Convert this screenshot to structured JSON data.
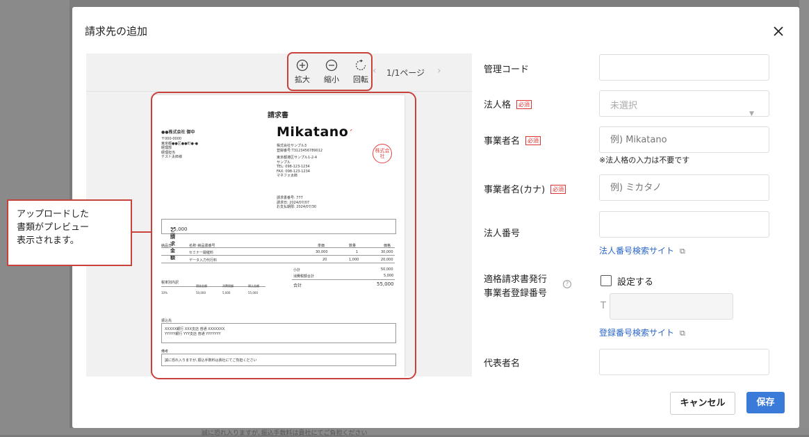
{
  "modal": {
    "title": "請求先の追加"
  },
  "preview": {
    "zoom_in_label": "拡大",
    "zoom_out_label": "縮小",
    "rotate_label": "回転",
    "pager": "1/1ページ"
  },
  "document": {
    "title": "請求書",
    "recipient": "●●株式会社 御中",
    "recipient_lines": [
      "〒000-0000",
      "東京都●●区●●町●-●",
      "経理部",
      "経理担当",
      "テスト太郎様"
    ],
    "logo": "Mikatano",
    "issuer_lines": [
      "株式会社サンプル3",
      "登録番号:T3123456789012",
      "",
      "東京都港区サンプル1-2-4",
      "サンプル",
      "TEL: 098-123-1234",
      "FAX: 098-123-1234",
      "マネフォ太郎"
    ],
    "meta_lines": [
      "請求書番号: 777",
      "請求日:    2024/07/07",
      "お支払期限: 2024/07/30"
    ],
    "seal_text": "株式会社",
    "amount_label": "ご請求金額",
    "amount_value": "55,000 円",
    "table_headers": [
      "納品日",
      "名称･納品書番号",
      "単価",
      "数量",
      "価格"
    ],
    "table_rows": [
      [
        "",
        "セミナー開催料",
        "30,000",
        "1",
        "30,000"
      ],
      [
        "",
        "データ入力代行料",
        "20",
        "1,000",
        "20,000"
      ]
    ],
    "tax_title": "税率別内訳",
    "tax_headers": [
      "税抜金額",
      "消費税額",
      "税込金額"
    ],
    "tax_row": [
      "10%",
      "50,000",
      "5,000",
      "55,000"
    ],
    "subtotal_label": "小計",
    "subtotal_value": "50,000",
    "tax_total_label": "消費税額合計",
    "tax_total_value": "5,000",
    "total_label": "合計",
    "total_value": "55,000",
    "bank_label": "振込先",
    "bank_lines": [
      "XXXXX銀行  XXX支店 普通  XXXXXXX",
      "YYYYY銀行  YYY支店 普通  YYYYYYY"
    ],
    "remarks_label": "備考",
    "remarks_text": "誠に恐れ入りますが､振込手数料は貴社にてご負担ください"
  },
  "form": {
    "management_code_label": "管理コード",
    "corporate_type_label": "法人格",
    "required_badge": "必須",
    "corporate_type_value": "未選択",
    "business_name_label": "事業者名",
    "business_name_placeholder": "例) Mikatano",
    "business_name_note": "※法人格の入力は不要です",
    "business_name_kana_label": "事業者名(カナ)",
    "business_name_kana_placeholder": "例) ミカタノ",
    "corporate_number_label": "法人番号",
    "corporate_number_link": "法人番号検索サイト",
    "invoice_reg_label_1": "適格請求書発行",
    "invoice_reg_label_2": "事業者登録番号",
    "invoice_reg_checkbox_label": "設定する",
    "invoice_reg_prefix": "T",
    "invoice_reg_link": "登録番号検索サイト",
    "representative_label": "代表者名"
  },
  "buttons": {
    "cancel": "キャンセル",
    "save": "保存"
  },
  "callout": {
    "text": "アップロードした\n書類がプレビュー\n表示されます。"
  },
  "background": {
    "bottom_text": "誠に恐れ入りますが､振込手数料は貴社にてご負担ください"
  },
  "colors": {
    "accent": "#3a7ad9",
    "link": "#2b66c8",
    "highlight": "#c8413a",
    "required": "#dd3333"
  }
}
